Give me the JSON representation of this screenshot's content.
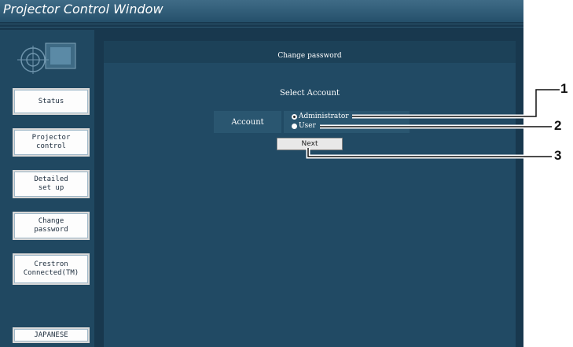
{
  "window": {
    "title": "Projector Control Window"
  },
  "sidebar": {
    "items": [
      {
        "label": "Status"
      },
      {
        "label": "Projector\ncontrol"
      },
      {
        "label": "Detailed\nset up"
      },
      {
        "label": "Change\npassword"
      },
      {
        "label": "Crestron\nConnected(TM)"
      },
      {
        "label": "JAPANESE"
      }
    ]
  },
  "main": {
    "title": "Change password",
    "select_heading": "Select Account",
    "account_label": "Account",
    "options": [
      {
        "label": "Administrator",
        "selected": true
      },
      {
        "label": "User",
        "selected": false
      }
    ],
    "next_label": "Next"
  },
  "callouts": [
    "1",
    "2",
    "3"
  ],
  "colors": {
    "background": "#18384e",
    "titlebar": "#3f6b86",
    "panel": "#214a64",
    "button": "#fdfdfd"
  }
}
